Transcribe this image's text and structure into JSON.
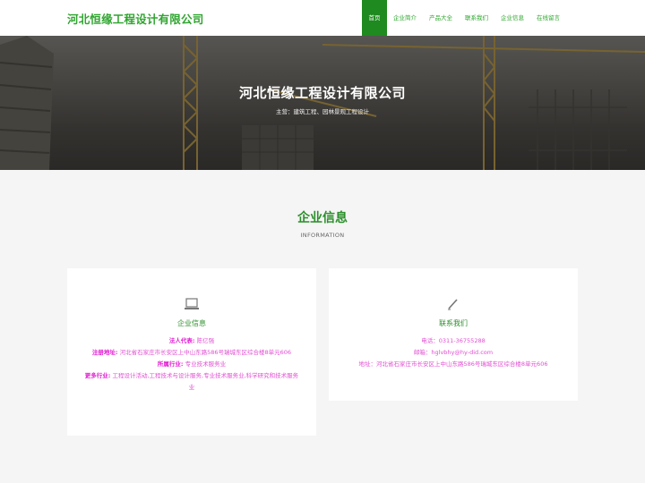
{
  "header": {
    "logo": "河北恒缘工程设计有限公司",
    "nav": [
      "首页",
      "企业简介",
      "产品大全",
      "联系我们",
      "企业信息",
      "在线留言"
    ]
  },
  "banner": {
    "title": "河北恒缘工程设计有限公司",
    "subtitle": "主营：建筑工程、园林景观工程设计"
  },
  "section": {
    "title": "企业信息",
    "subtitle": "INFORMATION"
  },
  "card_info": {
    "icon": "laptop-icon",
    "title": "企业信息",
    "legal_label": "法人代表:",
    "legal_value": "陈亿强",
    "address_label": "注册地址:",
    "address_value": "河北省石家庄市长安区上中山东路586号瑞城东区综合楼8单元606",
    "industry_label": "所属行业:",
    "industry_value": "专业技术服务业",
    "more_label": "更多行业:",
    "more_value": "工程设计活动,工程技术与设计服务,专业技术服务业,科学研究和技术服务业"
  },
  "card_contact": {
    "icon": "pencil-icon",
    "title": "联系我们",
    "phone": "电话：0311-36755288",
    "email": "邮箱：hglvbhy@hy-did.com",
    "address": "地址：河北省石家庄市长安区上中山东路586号瑞城东区综合楼8单元606"
  },
  "colors": {
    "brand_green": "#2fa52f",
    "nav_active": "#1f8a1f",
    "magenta_text": "#e14fd2"
  }
}
